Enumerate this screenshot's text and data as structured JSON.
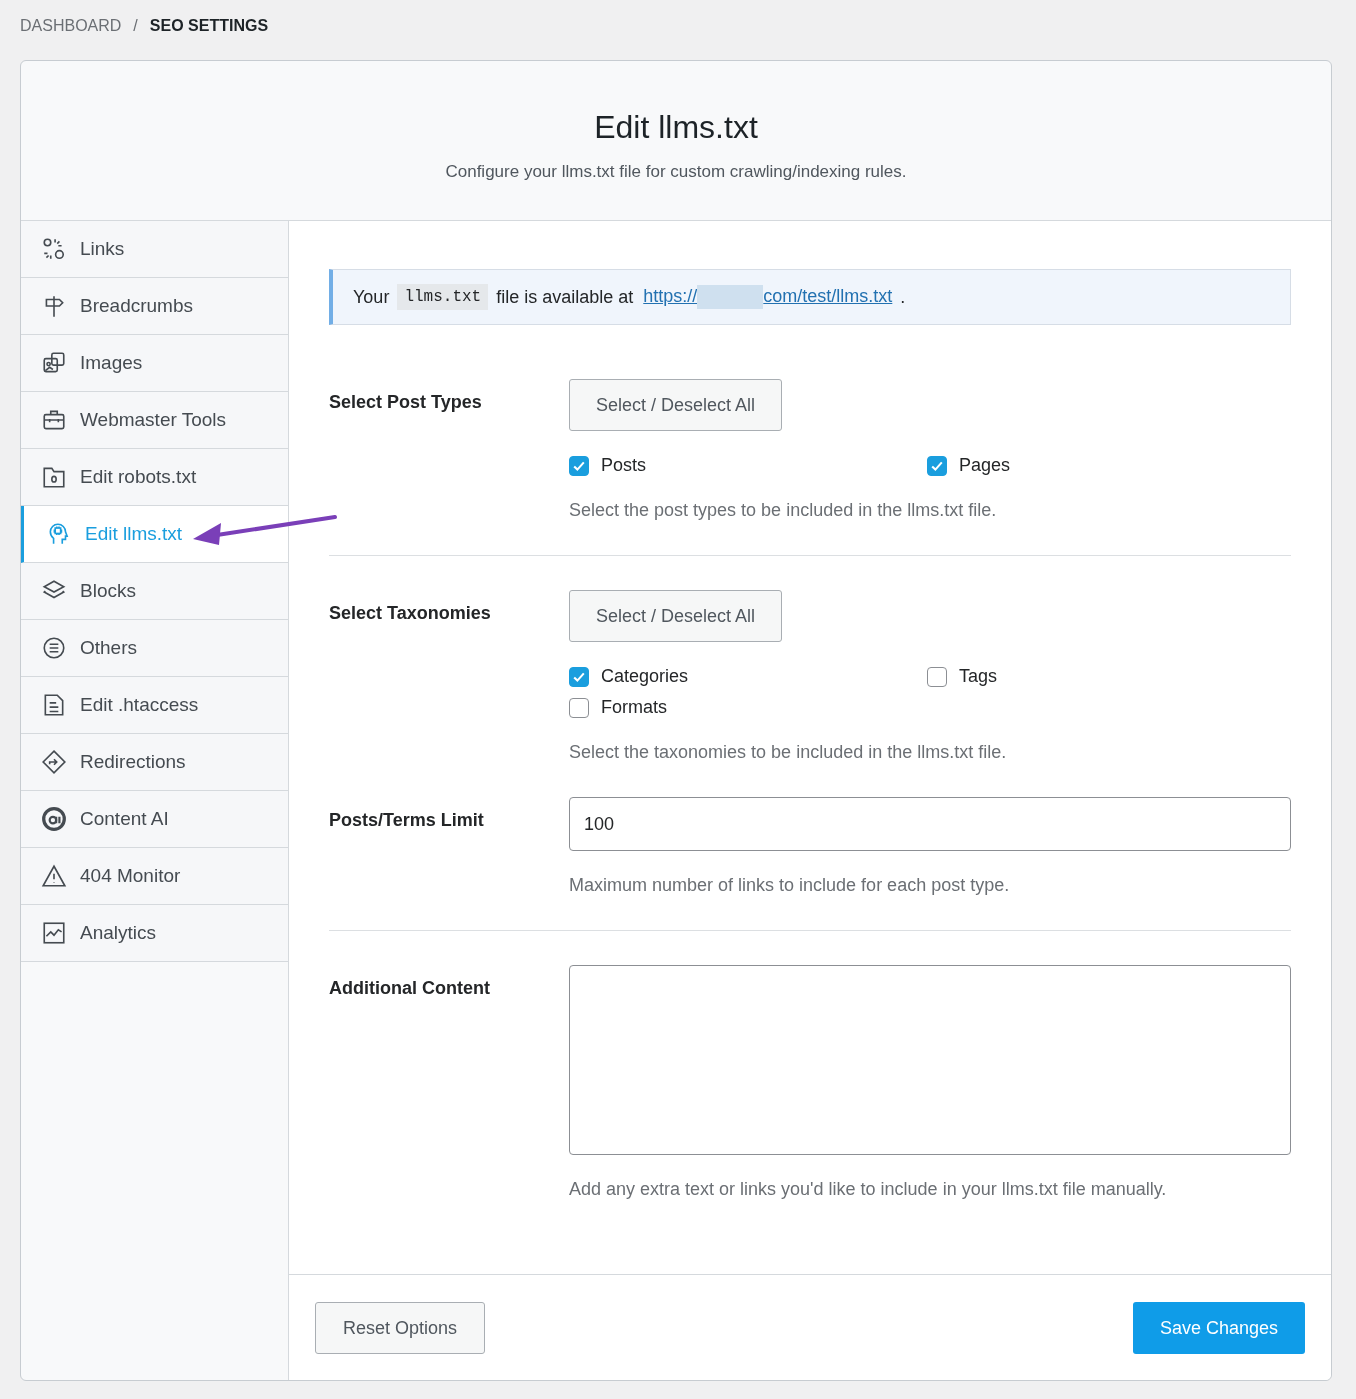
{
  "breadcrumb": {
    "separator": "/",
    "items": [
      {
        "label": "DASHBOARD",
        "current": false
      },
      {
        "label": "SEO SETTINGS",
        "current": true
      }
    ]
  },
  "header": {
    "title": "Edit llms.txt",
    "subtitle": "Configure your llms.txt file for custom crawling/indexing rules."
  },
  "sidebar": {
    "items": [
      {
        "label": "Links",
        "selected": false
      },
      {
        "label": "Breadcrumbs",
        "selected": false
      },
      {
        "label": "Images",
        "selected": false
      },
      {
        "label": "Webmaster Tools",
        "selected": false
      },
      {
        "label": "Edit robots.txt",
        "selected": false
      },
      {
        "label": "Edit llms.txt",
        "selected": true
      },
      {
        "label": "Blocks",
        "selected": false
      },
      {
        "label": "Others",
        "selected": false
      },
      {
        "label": "Edit .htaccess",
        "selected": false
      },
      {
        "label": "Redirections",
        "selected": false
      },
      {
        "label": "Content AI",
        "selected": false
      },
      {
        "label": "404 Monitor",
        "selected": false
      },
      {
        "label": "Analytics",
        "selected": false
      }
    ]
  },
  "notice": {
    "before": "Your",
    "code": "llms.txt",
    "middle": "file is available at",
    "url_start": "https://",
    "url_end": "com/test/llms.txt",
    "after": "."
  },
  "sections": [
    {
      "kind": "checkboxes",
      "label": "Select Post Types",
      "button": "Select / Deselect All",
      "divider": true,
      "options": [
        {
          "label": "Posts",
          "checked": true
        },
        {
          "label": "Pages",
          "checked": true
        }
      ],
      "help": "Select the post types to be included in the llms.txt file."
    },
    {
      "kind": "checkboxes",
      "label": "Select Taxonomies",
      "button": "Select / Deselect All",
      "divider": false,
      "options": [
        {
          "label": "Categories",
          "checked": true
        },
        {
          "label": "Tags",
          "checked": false
        },
        {
          "label": "Formats",
          "checked": false
        }
      ],
      "help": "Select the taxonomies to be included in the llms.txt file."
    },
    {
      "kind": "number",
      "label": "Posts/Terms Limit",
      "value": "100",
      "divider": true,
      "help": "Maximum number of links to include for each post type."
    },
    {
      "kind": "textarea",
      "label": "Additional Content",
      "divider": false,
      "help": "Add any extra text or links you'd like to include in your llms.txt file manually."
    }
  ],
  "footer": {
    "reset": "Reset Options",
    "save": "Save Changes"
  }
}
